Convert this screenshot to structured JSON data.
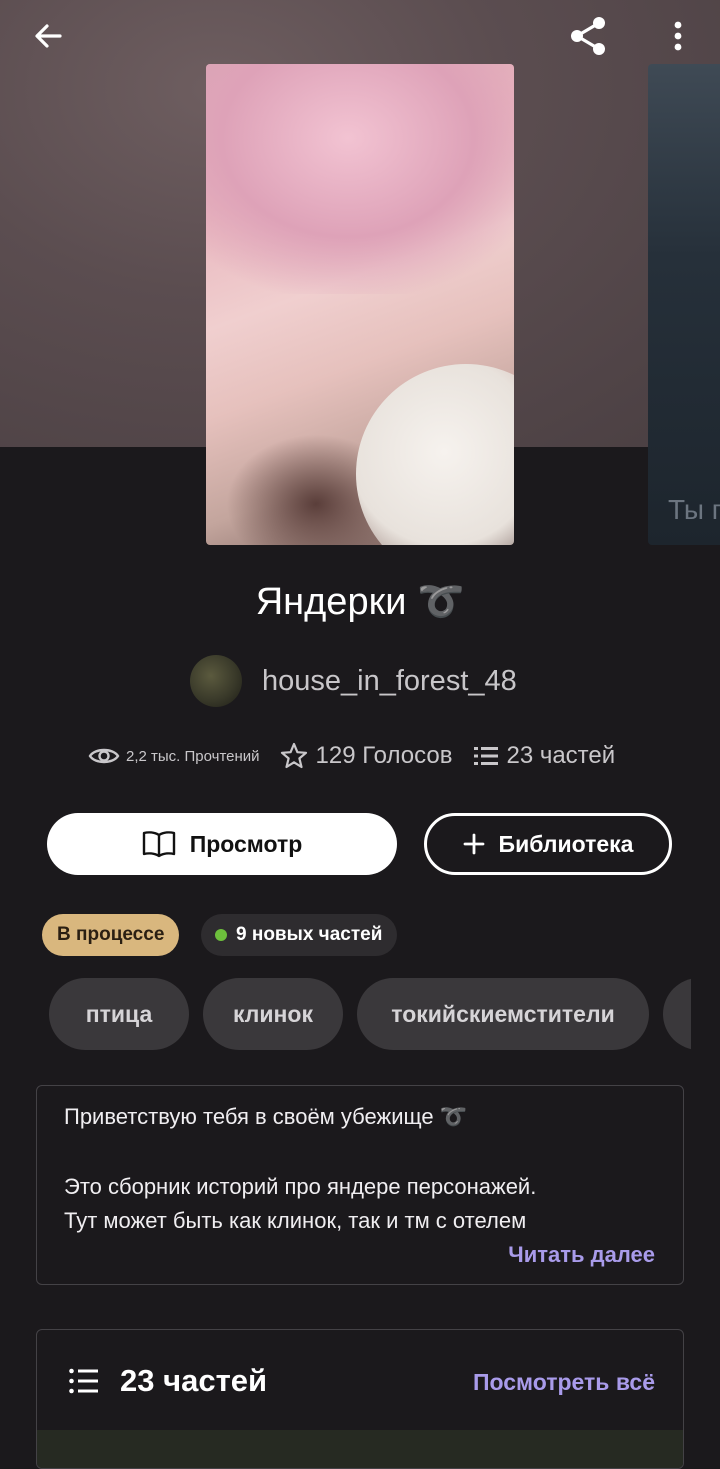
{
  "story": {
    "title": "Яндерки ➰",
    "author": "house_in_forest_48",
    "next_cover_peek": "Ты п"
  },
  "stats": {
    "reads": "2,2 тыс. Прочтений",
    "votes": "129 Голосов",
    "parts": "23 частей"
  },
  "actions": {
    "read_label": "Просмотр",
    "library_label": "Библиотека"
  },
  "badges": {
    "status": "В процессе",
    "new_parts": "9 новых частей",
    "status_color": "#d9b77e",
    "new_dot_color": "#6dbf3c"
  },
  "tags": [
    "птица",
    "клинок",
    "токийскиемстители"
  ],
  "description": {
    "line1": "Приветствую тебя в своём убежище ➰",
    "line2": "Это сборник историй про яндере персонажей.",
    "line3": "Тут может быть как клинок, так и тм с отелем",
    "read_more": "Читать далее"
  },
  "parts_section": {
    "title": "23 частей",
    "view_all": "Посмотреть всё"
  },
  "accent_color": "#a99bea"
}
